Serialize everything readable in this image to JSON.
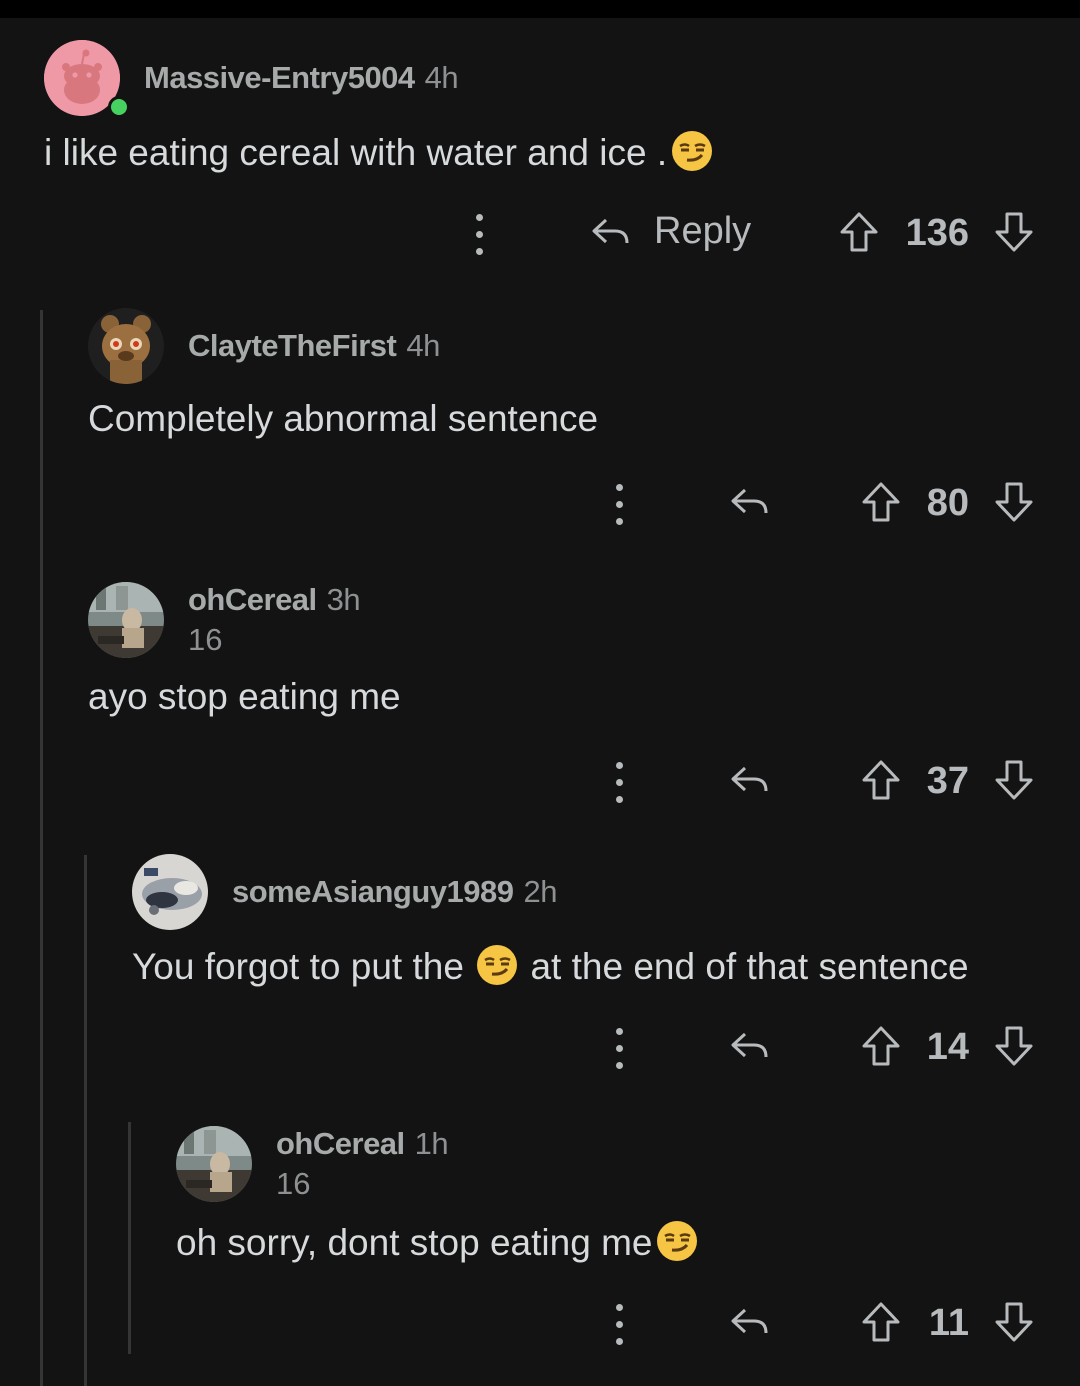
{
  "comments": [
    {
      "user": "Massive-Entry5004",
      "age": "4h",
      "text": "i like eating cereal with water and ice .",
      "score": "136",
      "reply_label": "Reply",
      "online": true
    },
    {
      "user": "ClayteTheFirst",
      "age": "4h",
      "text": "Completely abnormal sentence",
      "score": "80"
    },
    {
      "user": "ohCereal",
      "age": "3h",
      "karma": "16",
      "text": "ayo stop eating me",
      "score": "37"
    },
    {
      "user": "someAsianguy1989",
      "age": "2h",
      "text_before": "You forgot to put the",
      "text_after": "at the end of that sentence",
      "score": "14"
    },
    {
      "user": "ohCereal",
      "age": "1h",
      "karma": "16",
      "text": "oh sorry, dont stop eating me",
      "score": "11"
    }
  ],
  "icons": {
    "emoji": "smirk-emoji",
    "more": "more-vertical-icon",
    "reply": "reply-arrow-icon",
    "upvote": "upvote-arrow-icon",
    "downvote": "downvote-arrow-icon"
  },
  "colors": {
    "background": "#131313",
    "online": "#46d160",
    "text": "#d7dadc",
    "muted": "#8e9193"
  }
}
